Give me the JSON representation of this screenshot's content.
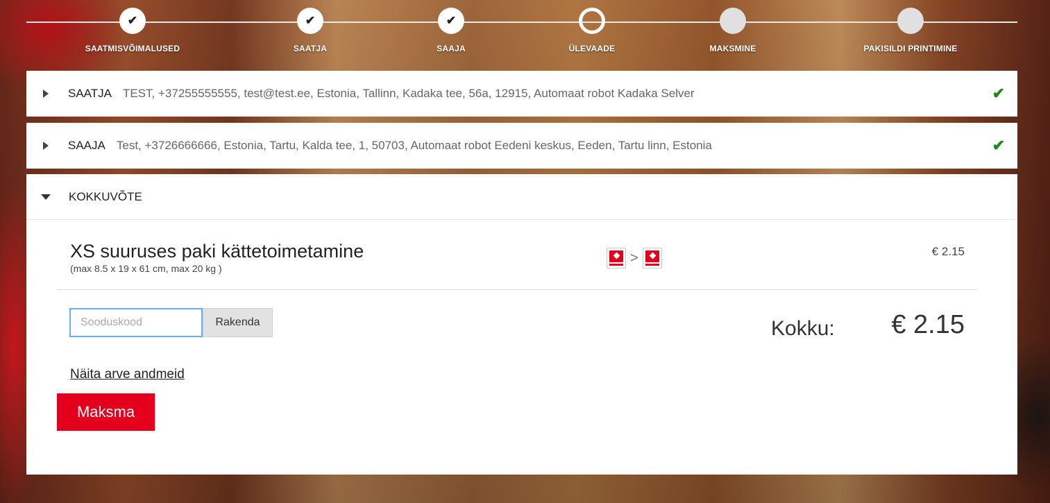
{
  "steps": [
    {
      "label": "SAATMISVÕIMALUSED",
      "state": "done",
      "icon": "check-icon"
    },
    {
      "label": "SAATJA",
      "state": "done",
      "icon": "check-icon"
    },
    {
      "label": "SAAJA",
      "state": "done",
      "icon": "check-icon"
    },
    {
      "label": "ÜLEVAADE",
      "state": "current",
      "icon": ""
    },
    {
      "label": "MAKSMINE",
      "state": "todo",
      "icon": ""
    },
    {
      "label": "PAKISILDI PRINTIMINE",
      "state": "todo",
      "icon": ""
    }
  ],
  "check_glyph": "✔",
  "sender": {
    "title": "SAATJA",
    "details": "TEST, +37255555555, test@test.ee, Estonia, Tallinn, Kadaka tee, 56a, 12915, Automaat robot Kadaka Selver",
    "status_icon": "check-icon"
  },
  "recipient": {
    "title": "SAAJA",
    "details": "Test, +3726666666, Estonia, Tartu, Kalda tee, 1, 50703, Automaat robot Eedeni keskus, Eeden, Tartu linn, Estonia",
    "status_icon": "check-icon"
  },
  "summary": {
    "title": "KOKKUVÕTE",
    "product_name": "XS suuruses paki kättetoimetamine",
    "product_dims": "(max 8.5 x 19 x 61 cm, max 20 kg )",
    "route_separator": ">",
    "price": "€ 2.15",
    "promo_placeholder": "Sooduskood",
    "promo_value": "",
    "apply_label": "Rakenda",
    "total_label": "Kokku:",
    "total_value": "€ 2.15",
    "invoice_link": "Näita arve andmeid",
    "pay_label": "Maksma"
  },
  "colors": {
    "brand_red": "#e4001c",
    "check_green": "#1e8a1e",
    "focus_blue": "#66aef0"
  }
}
